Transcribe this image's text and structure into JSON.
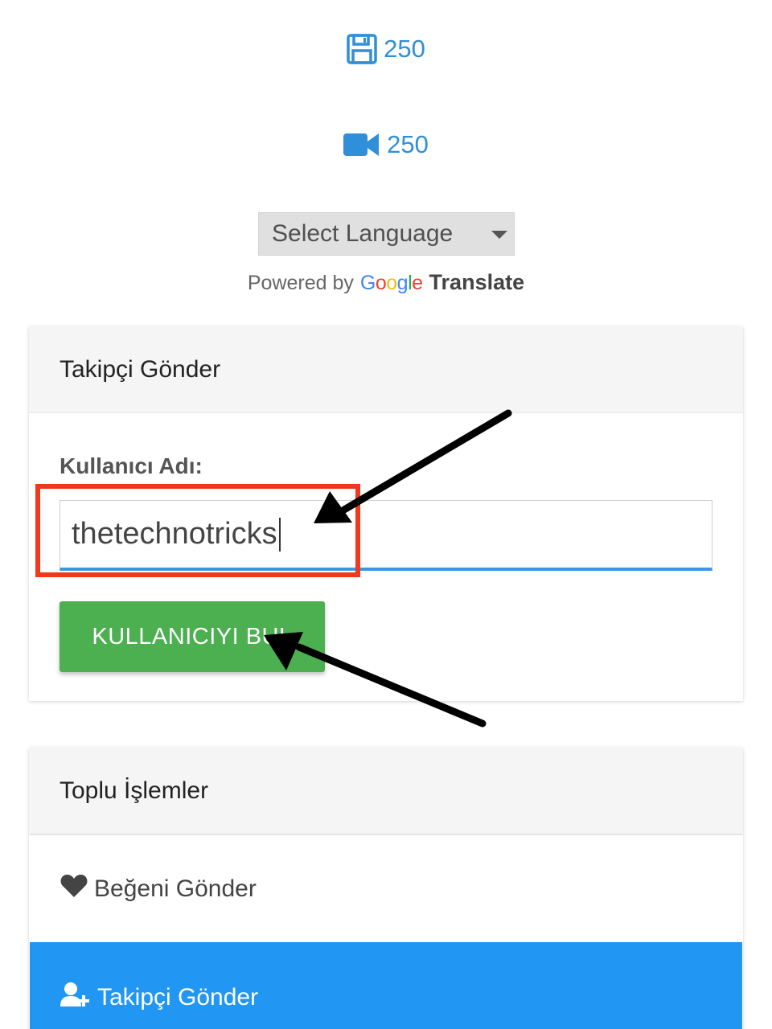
{
  "credits": [
    {
      "icon": "floppy-disk-icon",
      "value": "250"
    },
    {
      "icon": "video-camera-icon",
      "value": "250"
    }
  ],
  "language_select": {
    "selected": "Select Language"
  },
  "powered_by": {
    "prefix": "Powered by",
    "google_letters": [
      "G",
      "o",
      "o",
      "g",
      "l",
      "e"
    ],
    "product": "Translate"
  },
  "follower_card": {
    "title": "Takipçi Gönder",
    "username_label": "Kullanıcı Adı:",
    "username_value": "thetechnotricks",
    "find_button_label": "KULLANICIYI BUL"
  },
  "bulk_card": {
    "title": "Toplu İşlemler",
    "items": [
      {
        "label": "Beğeni Gönder",
        "icon": "heart-icon",
        "active": false
      },
      {
        "label": "Takipçi Gönder",
        "icon": "user-plus-icon",
        "active": true
      }
    ]
  },
  "colors": {
    "accent_blue": "#2196f3",
    "credit_blue": "#2f8fd8",
    "button_green": "#4caf50",
    "annotation_red": "#f0381d",
    "annotation_arrow": "#000000"
  }
}
